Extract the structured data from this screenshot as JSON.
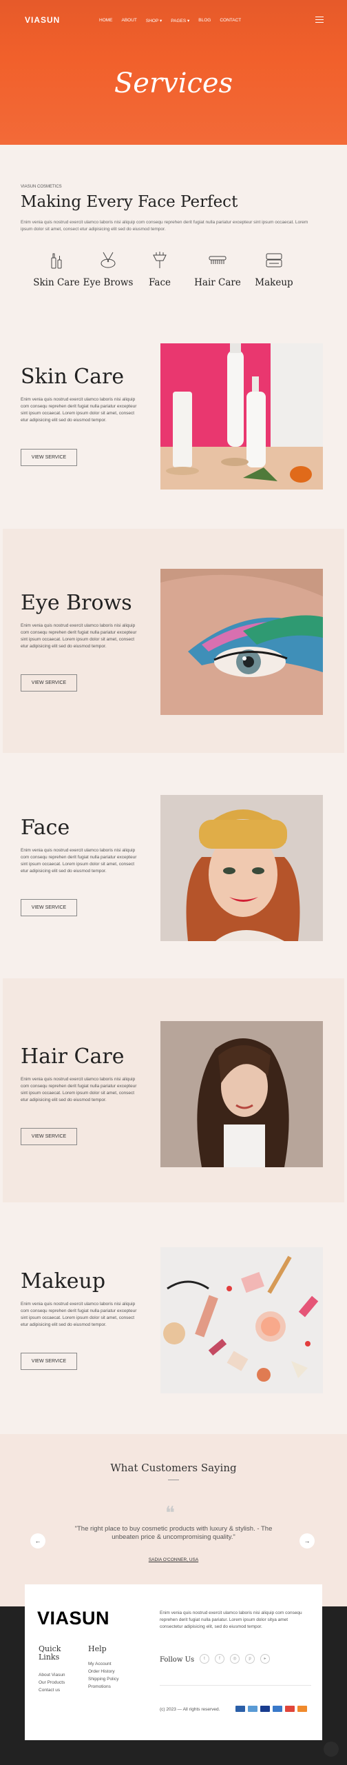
{
  "header": {
    "logo": "VIASUN",
    "nav": [
      "HOME",
      "ABOUT",
      "SHOP ▾",
      "PAGES ▾",
      "BLOG",
      "CONTACT"
    ],
    "menu_icon": "hamburger-icon"
  },
  "hero": {
    "title": "Services"
  },
  "intro": {
    "kicker": "VIASUN COSMETICS",
    "title": "Making Every Face Perfect",
    "text": "Enim venia quis nostrud exercit ulamco laboris nisi aliquip com consequ reprehen derit fugiat nulla pariatur excepteur sint ipsum occaecat. Lorem ipsum dolor sit amet, consect etur adipisicing elit sed do eiusmod tempor."
  },
  "categories": [
    {
      "label": "Skin Care",
      "icon": "lotion-bottles-icon"
    },
    {
      "label": "Eye Brows",
      "icon": "brush-and-tweezers-icon"
    },
    {
      "label": "Face",
      "icon": "makeup-brush-icon"
    },
    {
      "label": "Hair Care",
      "icon": "hair-comb-icon"
    },
    {
      "label": "Makeup",
      "icon": "compact-mirror-icon"
    }
  ],
  "services": [
    {
      "title": "Skin Care",
      "text": "Enim venia quis nostrud exercit ulamco laboris nisi aliquip com consequ reprehen derit fugiat nulla pariatur excepteur sint ipsum occaecat. Lorem ipsum dolor sit amet, consect etur adipisicing elit sed do eiusmod tempor.",
      "button": "VIEW SERVICE"
    },
    {
      "title": "Eye Brows",
      "text": "Enim venia quis nostrud exercit ulamco laboris nisi aliquip com consequ reprehen derit fugiat nulla pariatur excepteur sint ipsum occaecat. Lorem ipsum dolor sit amet, consect etur adipisicing elit sed do eiusmod tempor.",
      "button": "VIEW SERVICE"
    },
    {
      "title": "Face",
      "text": "Enim venia quis nostrud exercit ulamco laboris nisi aliquip com consequ reprehen derit fugiat nulla pariatur excepteur sint ipsum occaecat. Lorem ipsum dolor sit amet, consect etur adipisicing elit sed do eiusmod tempor.",
      "button": "VIEW SERVICE"
    },
    {
      "title": "Hair Care",
      "text": "Enim venia quis nostrud exercit ulamco laboris nisi aliquip com consequ reprehen derit fugiat nulla pariatur excepteur sint ipsum occaecat. Lorem ipsum dolor sit amet, consect etur adipisicing elit sed do eiusmod tempor.",
      "button": "VIEW SERVICE"
    },
    {
      "title": "Makeup",
      "text": "Enim venia quis nostrud exercit ulamco laboris nisi aliquip com consequ reprehen derit fugiat nulla pariatur excepteur sint ipsum occaecat. Lorem ipsum dolor sit amet, consect etur adipisicing elit sed do eiusmod tempor.",
      "button": "VIEW SERVICE"
    }
  ],
  "testimonials": {
    "title": "What Customers Saying",
    "quote": "\"The right place to buy cosmetic products with luxury & stylish. - The unbeaten price & uncompromising quality.\"",
    "author": "SADIA O'CONNER, USA",
    "prev": "←",
    "next": "→"
  },
  "footer": {
    "logo": "VIASUN",
    "about": "Enim venia quis nostrud exercit ulamco laboris nisi aliquip com consequ reprehen derit fugiat nulla pariatur. Lorem ipsum dolor sitya amet consectetur adipisicing elit, sed do eiusmod tempor.",
    "quick_links_title": "Quick Links",
    "quick_links": [
      "About Viasun",
      "Our Products",
      "Contact us"
    ],
    "help_title": "Help",
    "help_links": [
      "My Account",
      "Order History",
      "Shipping Policy",
      "Promotions"
    ],
    "follow_label": "Follow Us",
    "social": [
      {
        "icon": "twitter-icon",
        "glyph": "t"
      },
      {
        "icon": "facebook-icon",
        "glyph": "f"
      },
      {
        "icon": "instagram-icon",
        "glyph": "◎"
      },
      {
        "icon": "pinterest-icon",
        "glyph": "p"
      },
      {
        "icon": "youtube-icon",
        "glyph": "▸"
      }
    ],
    "copyright": "(c) 2023 — All rights reserved.",
    "payments": [
      {
        "icon": "paypal-icon",
        "color": "#2b5fa8"
      },
      {
        "icon": "amex-icon",
        "color": "#5a9bd5"
      },
      {
        "icon": "visa-icon",
        "color": "#1a3d8f"
      },
      {
        "icon": "visa-electron-icon",
        "color": "#3a79c9"
      },
      {
        "icon": "mastercard-icon",
        "color": "#e0453a"
      },
      {
        "icon": "discover-icon",
        "color": "#f08a2c"
      }
    ]
  },
  "colors": {
    "accent": "#f1602b",
    "background": "#f7f0ec",
    "alt_section": "#f4e8e1",
    "footer_dark": "#222222"
  }
}
